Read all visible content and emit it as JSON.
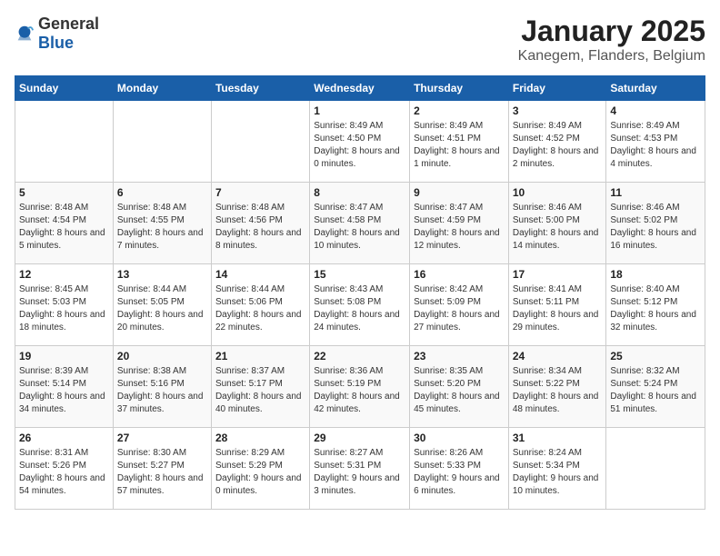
{
  "header": {
    "logo_general": "General",
    "logo_blue": "Blue",
    "month": "January 2025",
    "location": "Kanegem, Flanders, Belgium"
  },
  "days_of_week": [
    "Sunday",
    "Monday",
    "Tuesday",
    "Wednesday",
    "Thursday",
    "Friday",
    "Saturday"
  ],
  "weeks": [
    [
      {
        "day": "",
        "info": ""
      },
      {
        "day": "",
        "info": ""
      },
      {
        "day": "",
        "info": ""
      },
      {
        "day": "1",
        "info": "Sunrise: 8:49 AM\nSunset: 4:50 PM\nDaylight: 8 hours and 0 minutes."
      },
      {
        "day": "2",
        "info": "Sunrise: 8:49 AM\nSunset: 4:51 PM\nDaylight: 8 hours and 1 minute."
      },
      {
        "day": "3",
        "info": "Sunrise: 8:49 AM\nSunset: 4:52 PM\nDaylight: 8 hours and 2 minutes."
      },
      {
        "day": "4",
        "info": "Sunrise: 8:49 AM\nSunset: 4:53 PM\nDaylight: 8 hours and 4 minutes."
      }
    ],
    [
      {
        "day": "5",
        "info": "Sunrise: 8:48 AM\nSunset: 4:54 PM\nDaylight: 8 hours and 5 minutes."
      },
      {
        "day": "6",
        "info": "Sunrise: 8:48 AM\nSunset: 4:55 PM\nDaylight: 8 hours and 7 minutes."
      },
      {
        "day": "7",
        "info": "Sunrise: 8:48 AM\nSunset: 4:56 PM\nDaylight: 8 hours and 8 minutes."
      },
      {
        "day": "8",
        "info": "Sunrise: 8:47 AM\nSunset: 4:58 PM\nDaylight: 8 hours and 10 minutes."
      },
      {
        "day": "9",
        "info": "Sunrise: 8:47 AM\nSunset: 4:59 PM\nDaylight: 8 hours and 12 minutes."
      },
      {
        "day": "10",
        "info": "Sunrise: 8:46 AM\nSunset: 5:00 PM\nDaylight: 8 hours and 14 minutes."
      },
      {
        "day": "11",
        "info": "Sunrise: 8:46 AM\nSunset: 5:02 PM\nDaylight: 8 hours and 16 minutes."
      }
    ],
    [
      {
        "day": "12",
        "info": "Sunrise: 8:45 AM\nSunset: 5:03 PM\nDaylight: 8 hours and 18 minutes."
      },
      {
        "day": "13",
        "info": "Sunrise: 8:44 AM\nSunset: 5:05 PM\nDaylight: 8 hours and 20 minutes."
      },
      {
        "day": "14",
        "info": "Sunrise: 8:44 AM\nSunset: 5:06 PM\nDaylight: 8 hours and 22 minutes."
      },
      {
        "day": "15",
        "info": "Sunrise: 8:43 AM\nSunset: 5:08 PM\nDaylight: 8 hours and 24 minutes."
      },
      {
        "day": "16",
        "info": "Sunrise: 8:42 AM\nSunset: 5:09 PM\nDaylight: 8 hours and 27 minutes."
      },
      {
        "day": "17",
        "info": "Sunrise: 8:41 AM\nSunset: 5:11 PM\nDaylight: 8 hours and 29 minutes."
      },
      {
        "day": "18",
        "info": "Sunrise: 8:40 AM\nSunset: 5:12 PM\nDaylight: 8 hours and 32 minutes."
      }
    ],
    [
      {
        "day": "19",
        "info": "Sunrise: 8:39 AM\nSunset: 5:14 PM\nDaylight: 8 hours and 34 minutes."
      },
      {
        "day": "20",
        "info": "Sunrise: 8:38 AM\nSunset: 5:16 PM\nDaylight: 8 hours and 37 minutes."
      },
      {
        "day": "21",
        "info": "Sunrise: 8:37 AM\nSunset: 5:17 PM\nDaylight: 8 hours and 40 minutes."
      },
      {
        "day": "22",
        "info": "Sunrise: 8:36 AM\nSunset: 5:19 PM\nDaylight: 8 hours and 42 minutes."
      },
      {
        "day": "23",
        "info": "Sunrise: 8:35 AM\nSunset: 5:20 PM\nDaylight: 8 hours and 45 minutes."
      },
      {
        "day": "24",
        "info": "Sunrise: 8:34 AM\nSunset: 5:22 PM\nDaylight: 8 hours and 48 minutes."
      },
      {
        "day": "25",
        "info": "Sunrise: 8:32 AM\nSunset: 5:24 PM\nDaylight: 8 hours and 51 minutes."
      }
    ],
    [
      {
        "day": "26",
        "info": "Sunrise: 8:31 AM\nSunset: 5:26 PM\nDaylight: 8 hours and 54 minutes."
      },
      {
        "day": "27",
        "info": "Sunrise: 8:30 AM\nSunset: 5:27 PM\nDaylight: 8 hours and 57 minutes."
      },
      {
        "day": "28",
        "info": "Sunrise: 8:29 AM\nSunset: 5:29 PM\nDaylight: 9 hours and 0 minutes."
      },
      {
        "day": "29",
        "info": "Sunrise: 8:27 AM\nSunset: 5:31 PM\nDaylight: 9 hours and 3 minutes."
      },
      {
        "day": "30",
        "info": "Sunrise: 8:26 AM\nSunset: 5:33 PM\nDaylight: 9 hours and 6 minutes."
      },
      {
        "day": "31",
        "info": "Sunrise: 8:24 AM\nSunset: 5:34 PM\nDaylight: 9 hours and 10 minutes."
      },
      {
        "day": "",
        "info": ""
      }
    ]
  ]
}
